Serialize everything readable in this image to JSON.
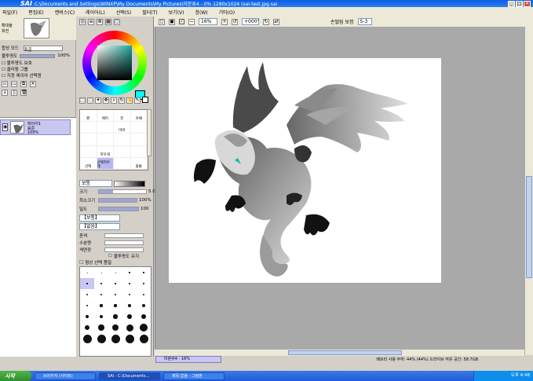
{
  "window": {
    "logo": "SAI",
    "title": "C:\\Documents and Settings\\WINXP\\My Documents\\My Pictures\\미분류4 - 0% 1280x1024 (sai-test.jpg.sai",
    "controls": [
      "_",
      "□",
      "×"
    ]
  },
  "menu": [
    "파일(F)",
    "편집(E)",
    "캔버스(C)",
    "레이어(L)",
    "선택(S)",
    "필터(T)",
    "보기(V)",
    "창(W)",
    "기타(O)"
  ],
  "toolbar": {
    "zoom": "16%",
    "rotate": "+000°",
    "antialias_label": "손떨림 보정",
    "stabilizer": "S-3"
  },
  "navigator": {
    "zoom_label": "확대율",
    "zoom_value": "16.7%",
    "angle_label": "회전",
    "angle_value": "+000"
  },
  "layer_panel": {
    "mode_label": "합성 모드",
    "mode_value": "표준",
    "opacity_label": "불투명도",
    "opacity_value": "100%",
    "protect_label": "불투명도 보호",
    "clip_label": "클리핑 그룹",
    "select_label": "지정 레이어 선택원",
    "layer_name": "레이어1",
    "layer_mode": "표준",
    "layer_opacity": "100%"
  },
  "tools": {
    "grid_top": [
      "",
      "",
      "",
      "",
      "",
      "",
      "",
      "",
      "",
      "",
      "",
      "",
      "",
      "",
      "",
      ""
    ],
    "grid_brushes": [
      "펜",
      "에어",
      "붓",
      "수채",
      "",
      "",
      "마커",
      "",
      "",
      "",
      "",
      "",
      "",
      "지우개",
      "",
      "",
      "선택",
      "선택지우개",
      "",
      "물통"
    ]
  },
  "brush": {
    "mode_label": "보통",
    "size_label": "크기",
    "size_value": "5.0",
    "min_label": "최소크기",
    "min_value": "100%",
    "density_label": "밀도",
    "density_value": "100",
    "shape_label": "【보통】",
    "texture_label": "【없음】",
    "blend_label": "혼색",
    "water_label": "수분량",
    "persistence_label": "색연장",
    "lock_label": "불투명도 유지",
    "quality_label": "형상 선택 품질",
    "quality_value": "0",
    "edge_label": "가장자리",
    "edge_value": "0",
    "pressure_label": "필압",
    "pressure_value": "0",
    "sizes": [
      "0.7",
      "0.8",
      "1",
      "1.5",
      "2",
      "2.3",
      "2.6",
      "3",
      "3.5",
      "4",
      "5",
      "6",
      "7",
      "8",
      "9",
      "10",
      "12",
      "14",
      "16",
      "20",
      "25",
      "30",
      "35",
      "40",
      "50",
      "60",
      "70",
      "80",
      "100",
      "120",
      "160",
      "200",
      "250",
      "300",
      "350"
    ]
  },
  "document_tab": "미분류4 - 16%",
  "status_bar": "메모리 사용 부하: 44% (44%)  드라이브 여유 공간: 58.7GB",
  "taskbar": {
    "start": "시작",
    "tasks": [
      "브라우저 (사이트)",
      "SAI - C:\\Documents...",
      "제목 없음 - 그림판"
    ],
    "clock": "오후 4:48"
  },
  "colors": {
    "foreground": "#00fff6",
    "background": "#ffffff",
    "selection": "#c9c7f2",
    "canvas_bg": "#a9a9a9"
  }
}
